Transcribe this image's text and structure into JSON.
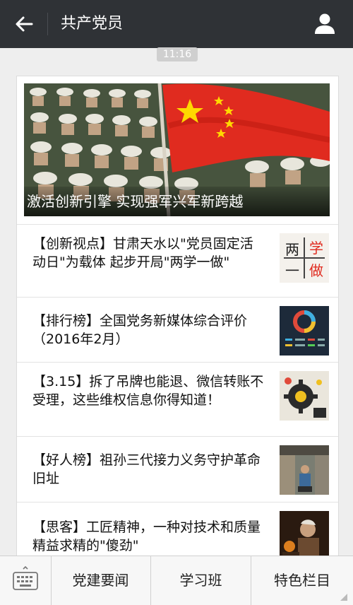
{
  "header": {
    "title": "共产党员",
    "back_icon": "arrow-left-icon",
    "profile_icon": "person-icon"
  },
  "message_time": "11:16",
  "article_card": {
    "hero": {
      "caption": "激活创新引擎 实现强军兴军新跨越"
    },
    "items": [
      {
        "text": "【创新视点】甘肃天水以\"党员固定活动日\"为载体 起步开局\"两学一做\"",
        "thumb_text": [
          "两",
          "学",
          "一",
          "做"
        ]
      },
      {
        "text": "【排行榜】全国党务新媒体综合评价（2016年2月）"
      },
      {
        "text": "【3.15】拆了吊牌也能退、微信转账不受理，这些维权信息你得知道！"
      },
      {
        "text": "【好人榜】祖孙三代接力义务守护革命旧址"
      },
      {
        "text": "【思客】工匠精神，一种对技术和质量精益求精的\"傻劲\""
      }
    ]
  },
  "bottom_menu": {
    "keyboard_icon": "keyboard-icon",
    "tabs": [
      "党建要闻",
      "学习班",
      "特色栏目"
    ]
  },
  "colors": {
    "header_bg": "#2f3236",
    "page_bg": "#eeeeee",
    "flag_red": "#e02b1f",
    "star_yellow": "#ffd800"
  }
}
